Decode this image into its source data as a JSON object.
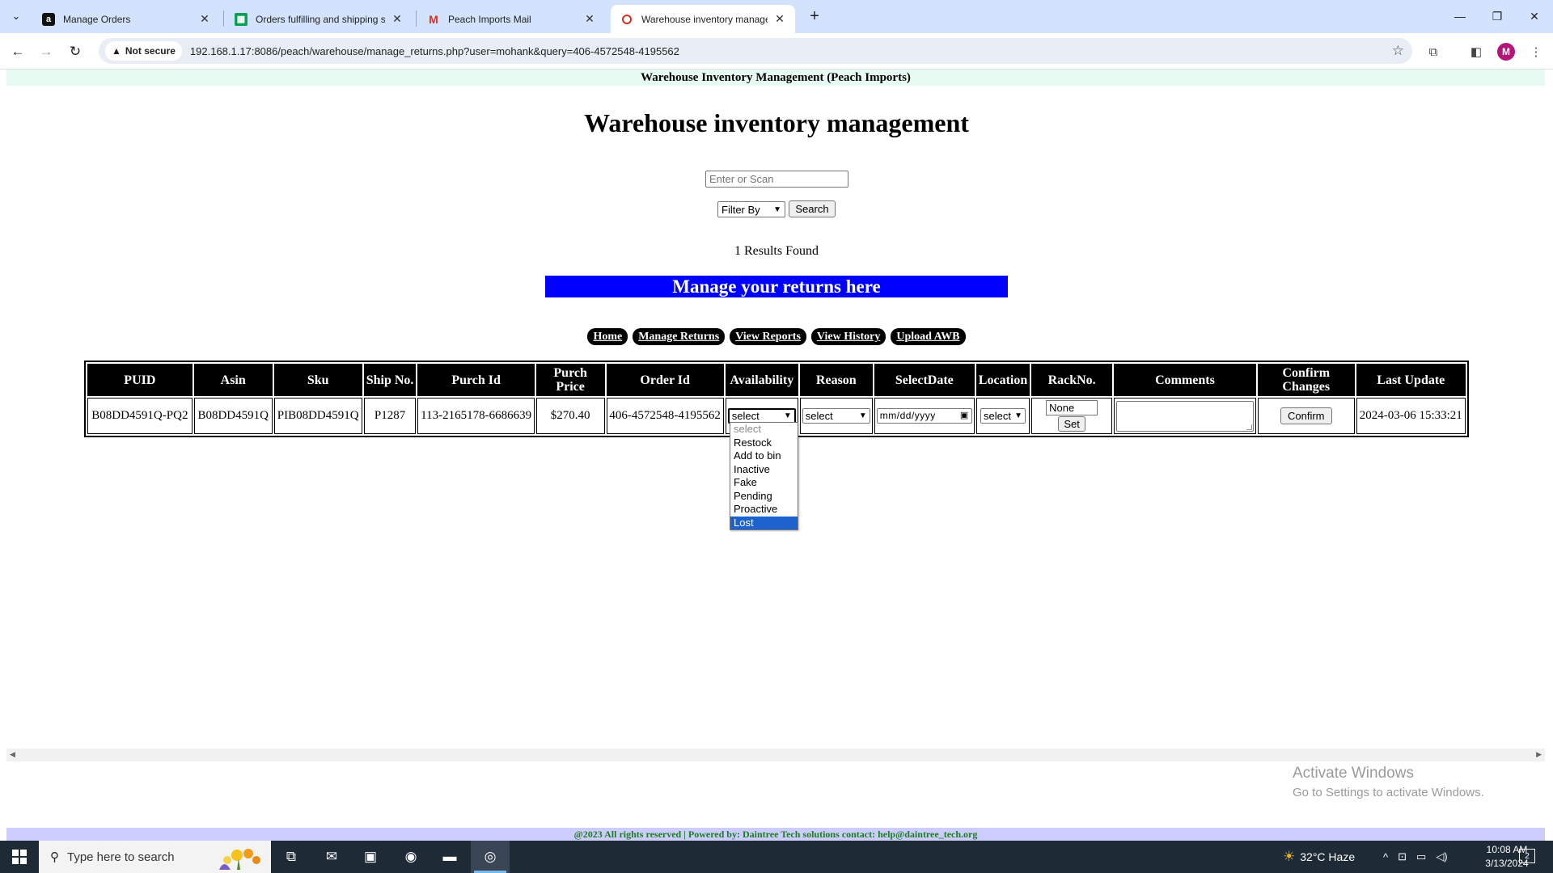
{
  "browser": {
    "tabs": [
      {
        "title": "Manage Orders",
        "icon": "amazon-icon"
      },
      {
        "title": "Orders fulfilling and shipping st",
        "icon": "sheets-icon"
      },
      {
        "title": "Peach Imports Mail",
        "icon": "gmail-icon"
      },
      {
        "title": "Warehouse inventory managem",
        "icon": "site-icon"
      }
    ],
    "security_label": "Not secure",
    "url": "192.168.1.17:8086/peach/warehouse/manage_returns.php?user=mohank&query=406-4572548-4195562",
    "profile_initial": "M"
  },
  "page": {
    "banner": "Warehouse Inventory Management (Peach Imports)",
    "title": "Warehouse inventory management",
    "search_placeholder": "Enter or Scan",
    "filter_label": "Filter By",
    "search_button": "Search",
    "results": "1 Results Found",
    "manage_banner": "Manage your returns here",
    "nav_buttons": [
      "Home",
      "Manage Returns",
      "View Reports",
      "View History",
      "Upload AWB"
    ],
    "footer": "@2023 All rights reserved | Powered by: Daintree Tech solutions contact: help@daintree_tech.org",
    "colors": {
      "manage_banner": "#0000ff",
      "site_banner": "#e8fbf3",
      "footer_bg": "#ccccff",
      "footer_text": "#1a7f1a"
    }
  },
  "table": {
    "headers": [
      "PUID",
      "Asin",
      "Sku",
      "Ship No.",
      "Purch Id",
      "Purch Price",
      "Order Id",
      "Availability",
      "Reason",
      "SelectDate",
      "Location",
      "RackNo.",
      "Comments",
      "Confirm Changes",
      "Last Update"
    ],
    "row": {
      "puid": "B08DD4591Q-PQ2",
      "asin": "B08DD4591Q",
      "sku": "PIB08DD4591Q",
      "ship_no": "P1287",
      "purch_id": "113-2165178-6686639",
      "purch_price": "$270.40",
      "order_id": "406-4572548-4195562",
      "availability": "select",
      "reason": "select",
      "date_placeholder": "mm/dd/yyyy",
      "location": "select",
      "rack_no": "None",
      "set_button": "Set",
      "confirm_button": "Confirm",
      "last_update": "2024-03-06 15:33:21"
    }
  },
  "availability_dropdown": {
    "options": [
      "select",
      "Restock",
      "Add to bin",
      "Inactive",
      "Fake",
      "Pending",
      "Proactive",
      "Lost"
    ],
    "highlighted": "Lost"
  },
  "watermark": {
    "line1": "Activate Windows",
    "line2": "Go to Settings to activate Windows."
  },
  "taskbar": {
    "search_placeholder": "Type here to search",
    "weather": "32°C  Haze",
    "time": "10:08 AM",
    "date": "3/13/2024",
    "notification_count": "2"
  }
}
